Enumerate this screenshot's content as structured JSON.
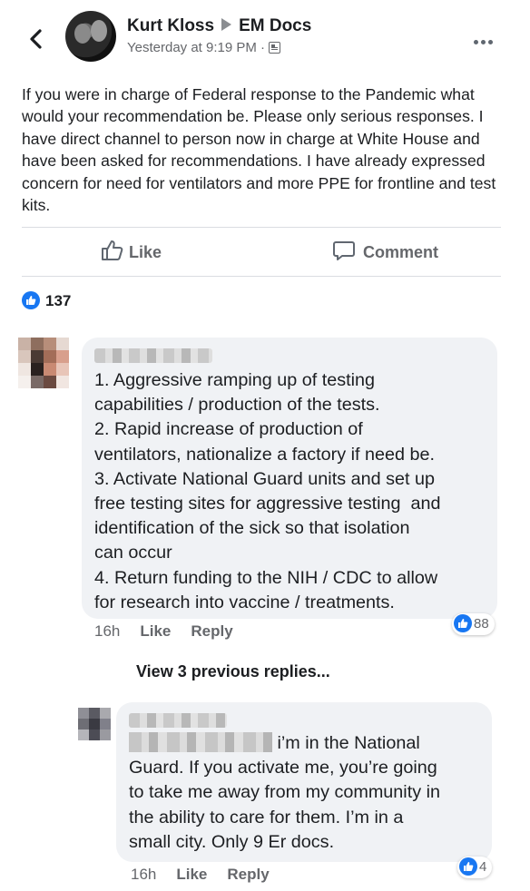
{
  "header": {
    "author": "Kurt Kloss",
    "group": "EM Docs",
    "timestamp": "Yesterday at 9:19 PM ·",
    "back_icon": "chevron-left-icon",
    "more_icon": "more-horizontal-icon",
    "audience_icon": "group-audience-icon"
  },
  "post": {
    "text": "If you were in charge of Federal response to the Pandemic what would your recommendation be. Please only serious responses. I have direct channel to person now in charge at White House and have been asked for recommendations. I have already expressed concern for need for ventilators and more PPE for frontline and test kits."
  },
  "actions": {
    "like_label": "Like",
    "comment_label": "Comment"
  },
  "reactions": {
    "count": "137"
  },
  "comments": [
    {
      "lines": [
        "1. Aggressive ramping up of testing",
        "capabilities / production of the tests.",
        "2. Rapid increase of production of",
        "ventilators, nationalize a factory if need be.",
        "3. Activate National Guard units and set up",
        "free testing sites for aggressive testing  and",
        "identification of the sick so that isolation",
        "can occur",
        "4. Return funding to the NIH / CDC to allow",
        "for research into vaccine / treatments."
      ],
      "time": "16h",
      "like": "Like",
      "reply": "Reply",
      "reaction_count": "88"
    },
    {
      "first_line": "i’m in the National",
      "lines": [
        "Guard. If you activate me, you’re going",
        "to take me away from my community in",
        "the ability to care for them. I’m in a",
        "small city. Only 9 Er docs."
      ],
      "time": "16h",
      "like": "Like",
      "reply": "Reply",
      "reaction_count": "4"
    }
  ],
  "view_previous": "View 3 previous replies...",
  "colors": {
    "accent": "#1877f2",
    "bubble": "#f0f2f5",
    "secondary_text": "#65676b"
  }
}
